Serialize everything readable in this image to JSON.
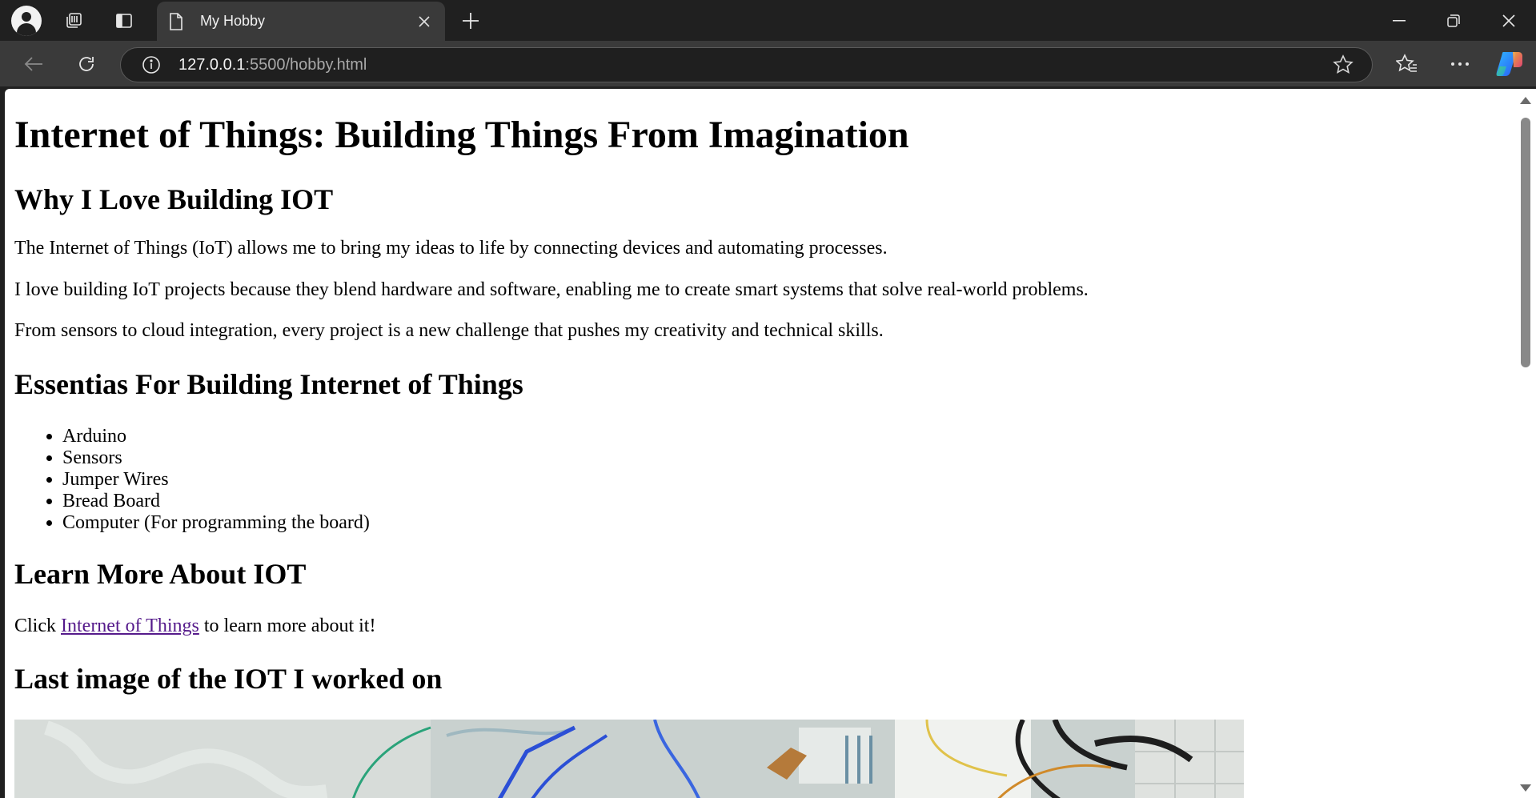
{
  "browser": {
    "tab_title": "My Hobby",
    "url_host": "127.0.0.1",
    "url_path": ":5500/hobby.html"
  },
  "page": {
    "title": "Internet of Things: Building Things From Imagination",
    "why_heading": "Why I Love Building IOT",
    "why_paragraphs": [
      "The Internet of Things (IoT) allows me to bring my ideas to life by connecting devices and automating processes.",
      "I love building IoT projects because they blend hardware and software, enabling me to create smart systems that solve real-world problems.",
      "From sensors to cloud integration, every project is a new challenge that pushes my creativity and technical skills."
    ],
    "essentials_heading": "Essentias For Building Internet of Things",
    "essentials": [
      "Arduino",
      "Sensors",
      "Jumper Wires",
      "Bread Board",
      "Computer (For programming the board)"
    ],
    "learn_heading": "Learn More About IOT",
    "learn_prefix": "Click",
    "learn_link": "Internet of Things",
    "learn_suffix": "to learn more about it!",
    "image_heading": "Last image of the IOT I worked on"
  },
  "icons": {
    "profile": "profile-icon",
    "workspaces": "workspaces-icon",
    "tab_actions": "tab-actions-icon",
    "page": "page-icon",
    "close": "close-icon",
    "new_tab": "plus-icon",
    "back": "back-arrow-icon",
    "reload": "reload-icon",
    "info": "info-icon",
    "favorite": "star-icon",
    "favorites": "favorites-icon",
    "more": "more-icon",
    "copilot": "copilot-icon"
  },
  "colors": {
    "link_visited": "#551a8b",
    "chrome_dark": "#202020",
    "tab_active": "#3a3a3a"
  }
}
